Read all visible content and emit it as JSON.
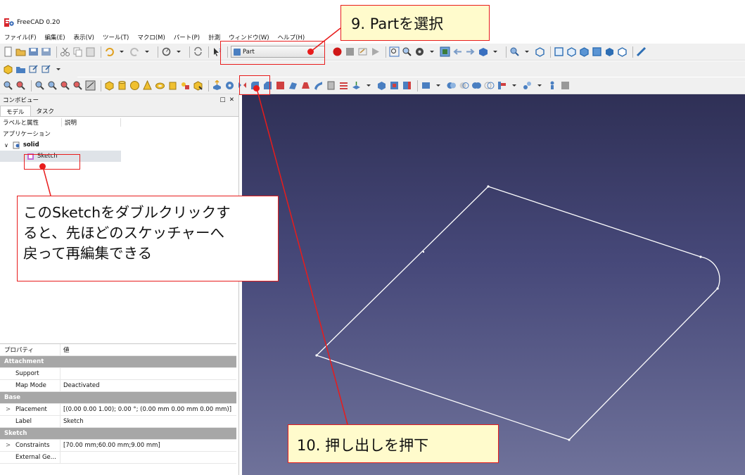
{
  "window": {
    "title": "FreeCAD 0.20"
  },
  "menu": [
    "ファイル(F)",
    "編集(E)",
    "表示(V)",
    "ツール(T)",
    "マクロ(M)",
    "パート(P)",
    "計測",
    "ウィンドウ(W)",
    "ヘルプ(H)"
  ],
  "toolbar": {
    "workbench_selected": "Part"
  },
  "combo_view": {
    "title": "コンボビュー",
    "tabs": [
      "モデル",
      "タスク"
    ],
    "tree_headers": [
      "ラベルと属性",
      "説明"
    ],
    "root_label": "アプリケーション",
    "document": "solid",
    "sketch_item": "Sketch"
  },
  "properties": {
    "headers": [
      "プロパティ",
      "値"
    ],
    "groups": [
      {
        "name": "Attachment",
        "rows": [
          {
            "key": "Support",
            "value": ""
          },
          {
            "key": "Map Mode",
            "value": "Deactivated"
          }
        ]
      },
      {
        "name": "Base",
        "rows": [
          {
            "key": "Placement",
            "value": "[(0.00 0.00 1.00); 0.00 °; (0.00 mm  0.00 mm  0.00 mm)]"
          },
          {
            "key": "Label",
            "value": "Sketch"
          }
        ]
      },
      {
        "name": "Sketch",
        "rows": [
          {
            "key": "Constraints",
            "value": "[70.00 mm;60.00 mm;9.00 mm]"
          },
          {
            "key": "External Ge...",
            "value": ""
          }
        ]
      }
    ]
  },
  "annotations": {
    "step9": "9. Partを選択",
    "step10": "10. 押し出しを押下",
    "sketch_note_line1": "このSketchをダブルクリックす",
    "sketch_note_line2": "ると、先ほどのスケッチャーへ",
    "sketch_note_line3": "戻って再編集できる"
  },
  "colors": {
    "accent": "#e81c1c",
    "callout_fill": "#fffbcc",
    "view_top": "#2f3056",
    "view_bottom": "#6f729a"
  }
}
